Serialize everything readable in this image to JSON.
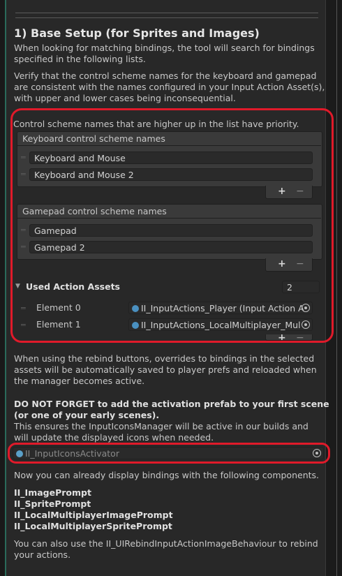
{
  "section": {
    "title": "1) Base Setup (for Sprites and Images)",
    "intro_lines": [
      "When looking for matching bindings, the tool will search for bindings",
      "specified in the following lists."
    ],
    "verify_lines": [
      "Verify that the control scheme names for the keyboard and gamepad",
      "are consistent with the names configured in your Input Action Asset(s),",
      "with upper and lower cases being inconsequential."
    ],
    "priority_note": "Control scheme names that are higher up in the list have priority."
  },
  "keyboard_list": {
    "label": "Keyboard control scheme names",
    "items": [
      "Keyboard and Mouse",
      "Keyboard and Mouse 2"
    ]
  },
  "gamepad_list": {
    "label": "Gamepad control scheme names",
    "items": [
      "Gamepad",
      "Gamepad 2"
    ]
  },
  "list_buttons": {
    "add": "+",
    "remove": "−"
  },
  "used_action_assets": {
    "label": "Used Action Assets",
    "size": "2",
    "elements": [
      {
        "label": "Element 0",
        "value": "II_InputActions_Player (Input Action A"
      },
      {
        "label": "Element 1",
        "value": "II_InputActions_LocalMultiplayer_Mul"
      }
    ]
  },
  "rebind_lines": [
    "When using the rebind buttons, overrides to bindings in the selected",
    "assets will be automatically saved to player prefs and reloaded when",
    "the manager becomes active."
  ],
  "warning_lines": [
    "DO NOT FORGET to add the activation prefab to your first scene",
    "(or one of your early scenes)."
  ],
  "ensure_lines": [
    "This ensures the InputIconsManager will be active in our builds and",
    "will update the displayed icons when needed."
  ],
  "activator_field": "II_InputIconsActivator",
  "components_intro": "Now you can already display bindings with the following components.",
  "components": [
    "II_ImagePrompt",
    "II_SpritePrompt",
    "II_LocalMultiplayerImagePrompt",
    "II_LocalMultiplayerSpritePrompt"
  ],
  "outro_lines": [
    "You can also use the II_UIRebindInputActionImageBehaviour to rebind",
    "your actions."
  ],
  "colors": {
    "highlight": "#e01a2a",
    "panel": "#282828",
    "field": "#2a2a2a"
  }
}
